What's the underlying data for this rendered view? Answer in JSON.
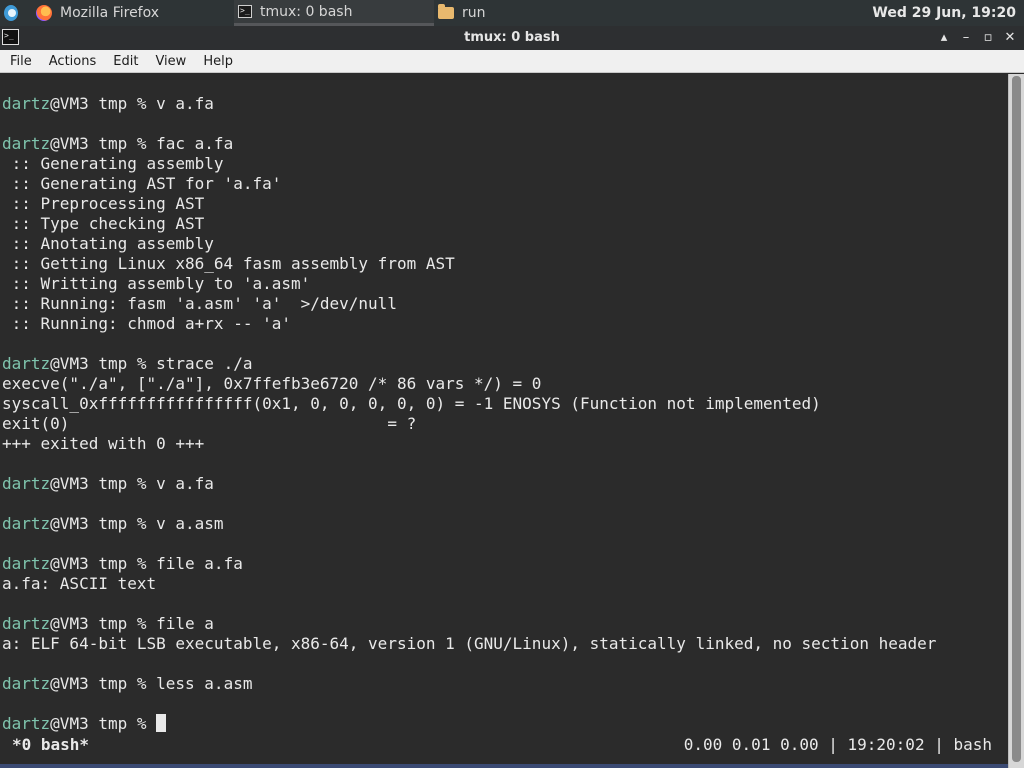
{
  "panel": {
    "taskbar": [
      {
        "label": "",
        "icon": "app-menu-icon"
      },
      {
        "label": "Mozilla Firefox",
        "icon": "firefox-icon"
      },
      {
        "label": "tmux: 0 bash",
        "icon": "terminal-icon"
      },
      {
        "label": "run",
        "icon": "folder-icon"
      }
    ],
    "clock": "Wed 29 Jun, 19:20"
  },
  "window": {
    "title": "tmux: 0 bash",
    "icon": "terminal-icon",
    "controls": [
      "▴",
      "–",
      "▫",
      "✕"
    ]
  },
  "menubar": [
    "File",
    "Actions",
    "Edit",
    "View",
    "Help"
  ],
  "terminal": {
    "user": "dartz",
    "prompt_suffix": "@VM3 tmp % ",
    "lines": [
      {
        "user": "dartz",
        "text": "@VM3 tmp % v a.fa"
      },
      {
        "user": "",
        "text": ""
      },
      {
        "user": "dartz",
        "text": "@VM3 tmp % fac a.fa"
      },
      {
        "user": "",
        "text": " :: Generating assembly"
      },
      {
        "user": "",
        "text": " :: Generating AST for 'a.fa'"
      },
      {
        "user": "",
        "text": " :: Preprocessing AST"
      },
      {
        "user": "",
        "text": " :: Type checking AST"
      },
      {
        "user": "",
        "text": " :: Anotating assembly"
      },
      {
        "user": "",
        "text": " :: Getting Linux x86_64 fasm assembly from AST"
      },
      {
        "user": "",
        "text": " :: Writting assembly to 'a.asm'"
      },
      {
        "user": "",
        "text": " :: Running: fasm 'a.asm' 'a'  >/dev/null"
      },
      {
        "user": "",
        "text": " :: Running: chmod a+rx -- 'a'"
      },
      {
        "user": "",
        "text": ""
      },
      {
        "user": "dartz",
        "text": "@VM3 tmp % strace ./a"
      },
      {
        "user": "",
        "text": "execve(\"./a\", [\"./a\"], 0x7ffefb3e6720 /* 86 vars */) = 0"
      },
      {
        "user": "",
        "text": "syscall_0xffffffffffffffff(0x1, 0, 0, 0, 0, 0) = -1 ENOSYS (Function not implemented)"
      },
      {
        "user": "",
        "text": "exit(0)                                 = ?"
      },
      {
        "user": "",
        "text": "+++ exited with 0 +++"
      },
      {
        "user": "",
        "text": ""
      },
      {
        "user": "dartz",
        "text": "@VM3 tmp % v a.fa"
      },
      {
        "user": "",
        "text": ""
      },
      {
        "user": "dartz",
        "text": "@VM3 tmp % v a.asm"
      },
      {
        "user": "",
        "text": ""
      },
      {
        "user": "dartz",
        "text": "@VM3 tmp % file a.fa"
      },
      {
        "user": "",
        "text": "a.fa: ASCII text"
      },
      {
        "user": "",
        "text": ""
      },
      {
        "user": "dartz",
        "text": "@VM3 tmp % file a"
      },
      {
        "user": "",
        "text": "a: ELF 64-bit LSB executable, x86-64, version 1 (GNU/Linux), statically linked, no section header"
      },
      {
        "user": "",
        "text": ""
      },
      {
        "user": "dartz",
        "text": "@VM3 tmp % less a.asm"
      },
      {
        "user": "",
        "text": ""
      }
    ],
    "current_prompt": {
      "user": "dartz",
      "text": "@VM3 tmp % "
    }
  },
  "tmux_status": {
    "left": "*0 bash*",
    "right": "0.00 0.01 0.00 | 19:20:02 | bash"
  },
  "colors": {
    "prompt_user": "#7fc4ad",
    "terminal_bg": "#2b2b2b"
  }
}
